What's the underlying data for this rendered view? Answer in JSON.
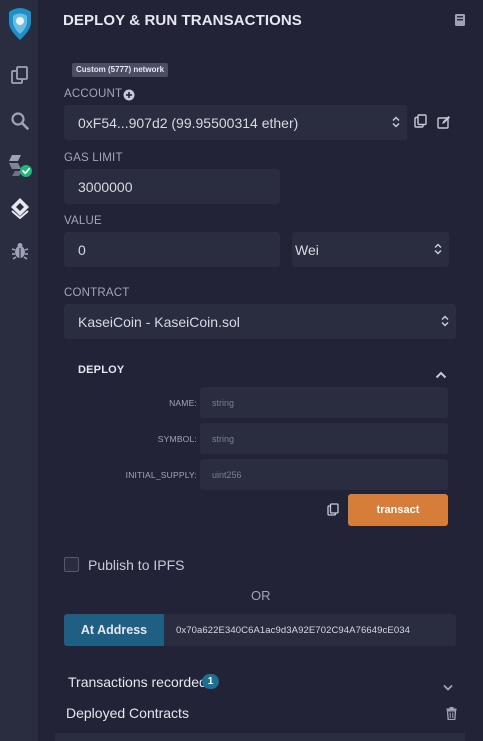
{
  "header": {
    "title": "DEPLOY & RUN TRANSACTIONS"
  },
  "network": {
    "badge": "Custom (5777) network"
  },
  "account": {
    "label": "ACCOUNT",
    "value": "0xF54...907d2 (99.95500314 ether)"
  },
  "gas_limit": {
    "label": "GAS LIMIT",
    "value": "3000000"
  },
  "value": {
    "label": "VALUE",
    "amount": "0",
    "unit": "Wei"
  },
  "contract": {
    "label": "CONTRACT",
    "selected": "KaseiCoin - KaseiCoin.sol"
  },
  "deploy": {
    "title": "DEPLOY",
    "params": [
      {
        "label": "NAME:",
        "placeholder": "string"
      },
      {
        "label": "SYMBOL:",
        "placeholder": "string"
      },
      {
        "label": "INITIAL_SUPPLY:",
        "placeholder": "uint256"
      }
    ],
    "transact_label": "transact"
  },
  "publish": {
    "label": "Publish to IPFS"
  },
  "or_label": "OR",
  "at_address": {
    "button_label": "At Address",
    "value": "0x70a622E340C6A1ac9d3A92E702C94A76649cE034"
  },
  "transactions": {
    "label": "Transactions recorded",
    "count": "1"
  },
  "deployed": {
    "label": "Deployed Contracts"
  },
  "colors": {
    "accent_orange": "#d77d3a",
    "accent_blue": "#1f5f84",
    "panel_bg": "#222336",
    "input_bg": "#2a2c3f",
    "check_green": "#1fb77a"
  },
  "icons": {
    "sidebar": [
      "remix-logo-icon",
      "file-explorer-icon",
      "search-icon",
      "solidity-compiler-icon",
      "deploy-run-icon",
      "debugger-icon"
    ],
    "header": "book-docs-icon"
  }
}
